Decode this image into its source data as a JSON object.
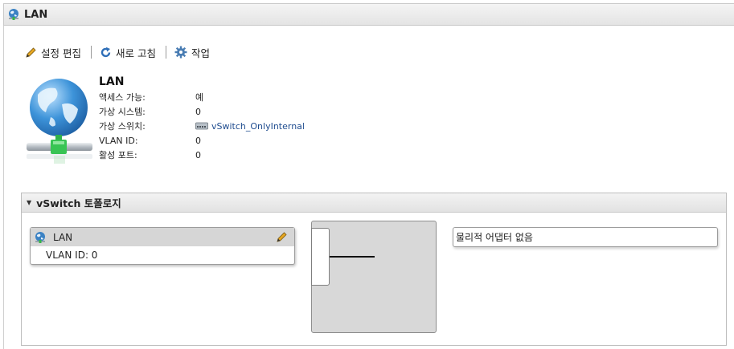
{
  "window": {
    "title": "LAN",
    "icon": "network-globe-icon"
  },
  "toolbar": {
    "edit_label": "설정 편집",
    "refresh_label": "새로 고침",
    "actions_label": "작업",
    "edit_icon": "pencil-icon",
    "refresh_icon": "refresh-icon",
    "actions_icon": "gear-icon"
  },
  "info": {
    "title": "LAN",
    "rows": [
      {
        "label": "액세스 가능:",
        "value": "예"
      },
      {
        "label": "가상 시스템:",
        "value": "0"
      },
      {
        "label": "가상 스위치:",
        "value": "vSwitch_OnlyInternal",
        "icon": "switch-icon",
        "link": true
      },
      {
        "label": "VLAN ID:",
        "value": "0"
      },
      {
        "label": "활성 포트:",
        "value": "0"
      }
    ]
  },
  "topology": {
    "header": "vSwitch 토폴로지",
    "port_group": {
      "name": "LAN",
      "vlan": "VLAN ID: 0"
    },
    "adapter_text": "물리적 어댑터 없음"
  },
  "colors": {
    "link": "#1f4c8f",
    "panel_header": "#e2e2e2",
    "switch_fill": "#d8d8d8"
  }
}
